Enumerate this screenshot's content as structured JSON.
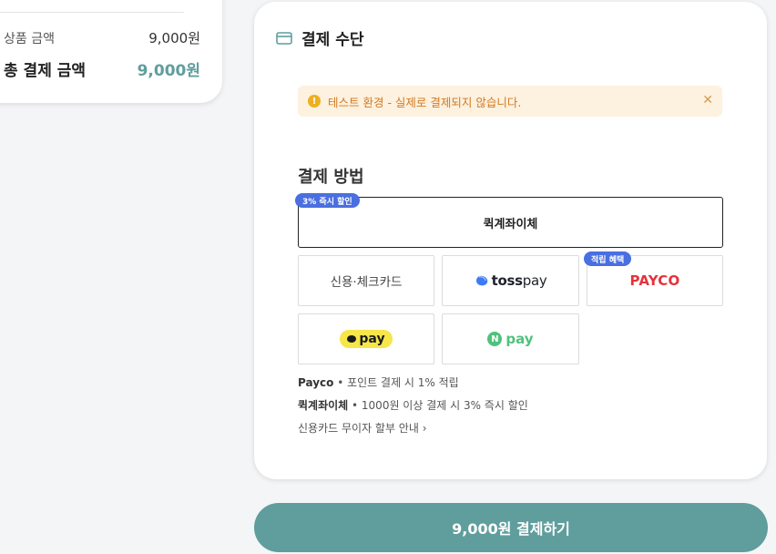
{
  "summary": {
    "product_amount_label": "상품 금액",
    "product_amount_value": "9,000원",
    "total_label": "총 결제 금액",
    "total_value": "9,000원"
  },
  "payment": {
    "title": "결제 수단",
    "alert_text": "테스트 환경 - 실제로 결제되지 않습니다.",
    "alert_icon": "!",
    "alert_close": "✕",
    "method_title": "결제 방법",
    "methods": {
      "quick_transfer": "퀵계좌이체",
      "quick_badge": "3% 즉시 할인",
      "card": "신용·체크카드",
      "toss_a": "toss",
      "toss_b": "pay",
      "payco": "PAYCO",
      "payco_badge": "적립 혜택",
      "kakao": "pay",
      "naver_n": "N",
      "naver": "pay"
    },
    "info": {
      "line1_brand": "Payco",
      "line1_text": " • 포인트 결제 시 1% 적립",
      "line2_brand": "퀵계좌이체",
      "line2_text": " • 1000원 이상 결제 시 3% 즉시 할인",
      "line3": "신용카드 무이자 할부 안내 ›"
    }
  },
  "pay_button": "9,000원 결제하기",
  "colors": {
    "accent": "#5f9e9d",
    "badge": "#4a6fe0",
    "alert_bg": "#fdf1df",
    "alert_text": "#d17a22",
    "payco": "#e5323b",
    "naver": "#4fc27c",
    "kakao": "#f6e64a"
  }
}
